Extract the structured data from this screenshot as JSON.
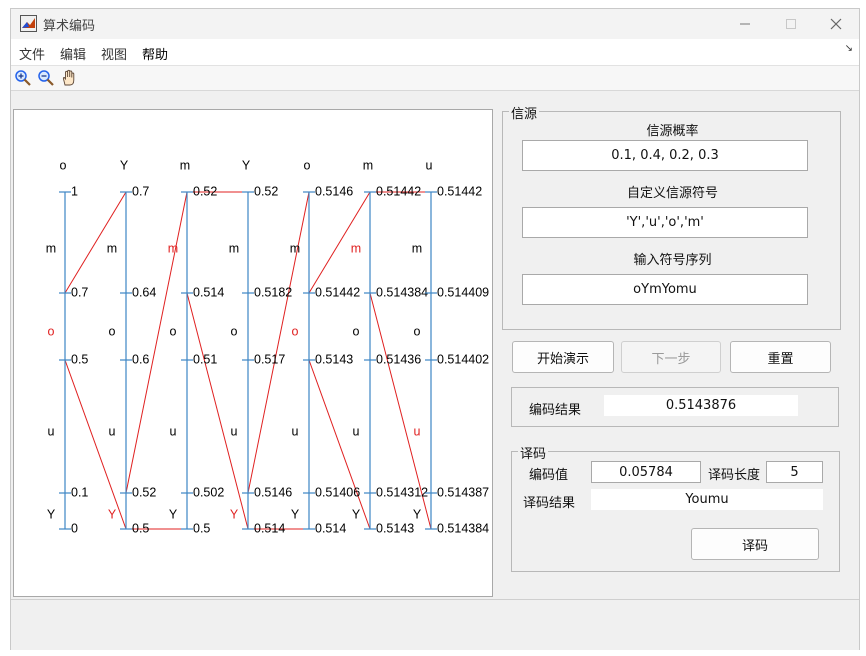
{
  "window": {
    "title": "算术编码"
  },
  "menu": [
    "文件",
    "编辑",
    "视图",
    "帮助"
  ],
  "toolbar": {
    "icons": [
      "zoom-in-icon",
      "zoom-out-icon",
      "pan-hand-icon"
    ]
  },
  "source": {
    "group_title": "信源",
    "prob_label": "信源概率",
    "prob_value": "0.1, 0.4, 0.2, 0.3",
    "symbols_label": "自定义信源符号",
    "symbols_value": "'Y','u','o','m'",
    "sequence_label": "输入符号序列",
    "sequence_value": "oYmYomu"
  },
  "buttons": {
    "start": "开始演示",
    "next": "下一步",
    "reset": "重置",
    "decode": "译码"
  },
  "encode": {
    "label": "编码结果",
    "value": "0.5143876"
  },
  "decode": {
    "group_title": "译码",
    "code_label": "编码值",
    "code_value": "0.05784",
    "length_label": "译码长度",
    "length_value": "5",
    "result_label": "译码结果",
    "result_value": "Youmu"
  },
  "colors": {
    "axis": "#3d86c4",
    "highlight": "#e02020",
    "text": "#000000"
  },
  "chart_data": {
    "type": "diagram",
    "top_symbols": [
      "o",
      "Y",
      "m",
      "Y",
      "o",
      "m",
      "u"
    ],
    "row_symbols": [
      "m",
      "o",
      "u",
      "Y"
    ],
    "columns": [
      {
        "ticks": [
          "1",
          "0.7",
          "0.5",
          "0.1",
          "0"
        ],
        "highlight": "o"
      },
      {
        "ticks": [
          "0.7",
          "0.64",
          "0.6",
          "0.52",
          "0.5"
        ],
        "highlight": "Y"
      },
      {
        "ticks": [
          "0.52",
          "0.514",
          "0.51",
          "0.502",
          "0.5"
        ],
        "highlight": "m"
      },
      {
        "ticks": [
          "0.52",
          "0.5182",
          "0.517",
          "0.5146",
          "0.514"
        ],
        "highlight": "Y"
      },
      {
        "ticks": [
          "0.5146",
          "0.51442",
          "0.5143",
          "0.51406",
          "0.514"
        ],
        "highlight": "o"
      },
      {
        "ticks": [
          "0.51442",
          "0.514384",
          "0.51436",
          "0.514312",
          "0.5143"
        ],
        "highlight": "m"
      },
      {
        "ticks": [
          "0.51442",
          "0.514409",
          "0.514402",
          "0.514387",
          "0.514384"
        ],
        "highlight": "u"
      }
    ]
  }
}
